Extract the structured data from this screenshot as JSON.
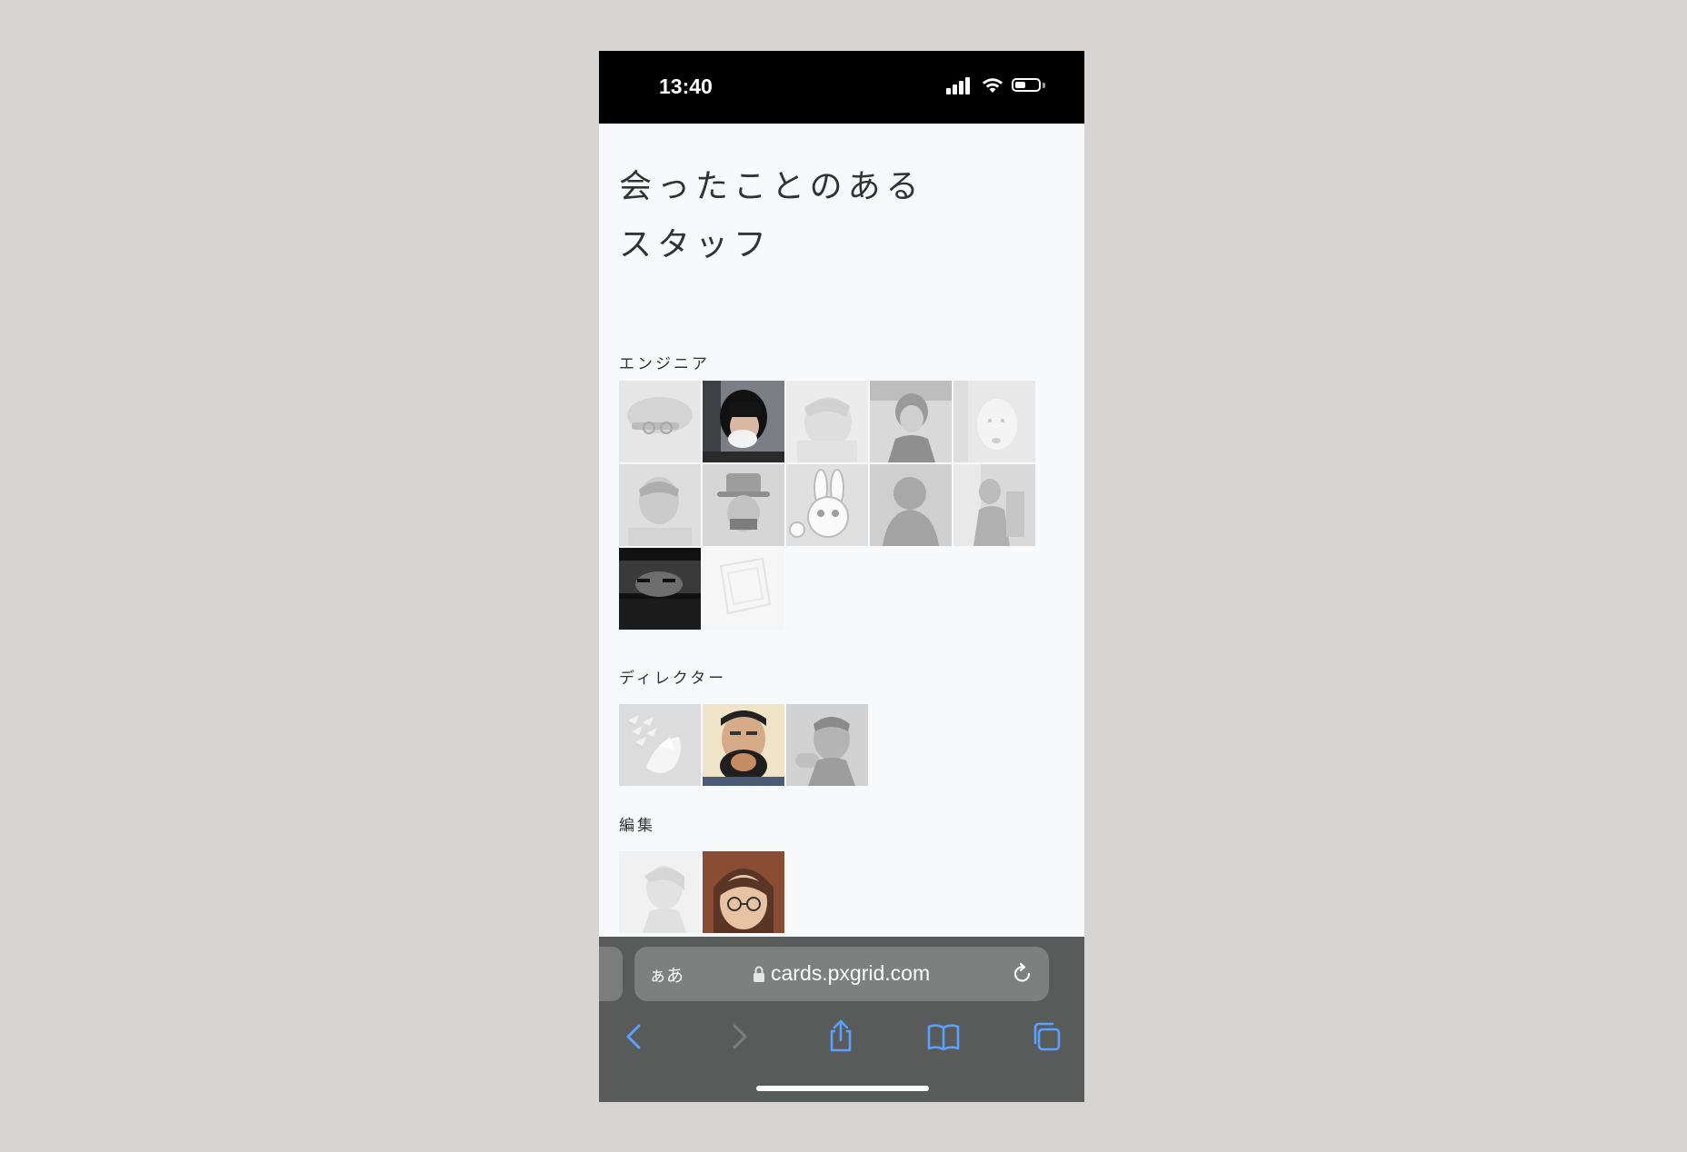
{
  "status": {
    "time": "13:40"
  },
  "page": {
    "title_line1": "会ったことのある",
    "title_line2": "スタッフ"
  },
  "sections": [
    {
      "label": "エンジニア"
    },
    {
      "label": "ディレクター"
    },
    {
      "label": "編集"
    }
  ],
  "browser": {
    "aa_label": "ぁあ",
    "url": "cards.pxgrid.com"
  },
  "colors": {
    "accent": "#5aa0ff",
    "toolbar": "#595a5a"
  }
}
